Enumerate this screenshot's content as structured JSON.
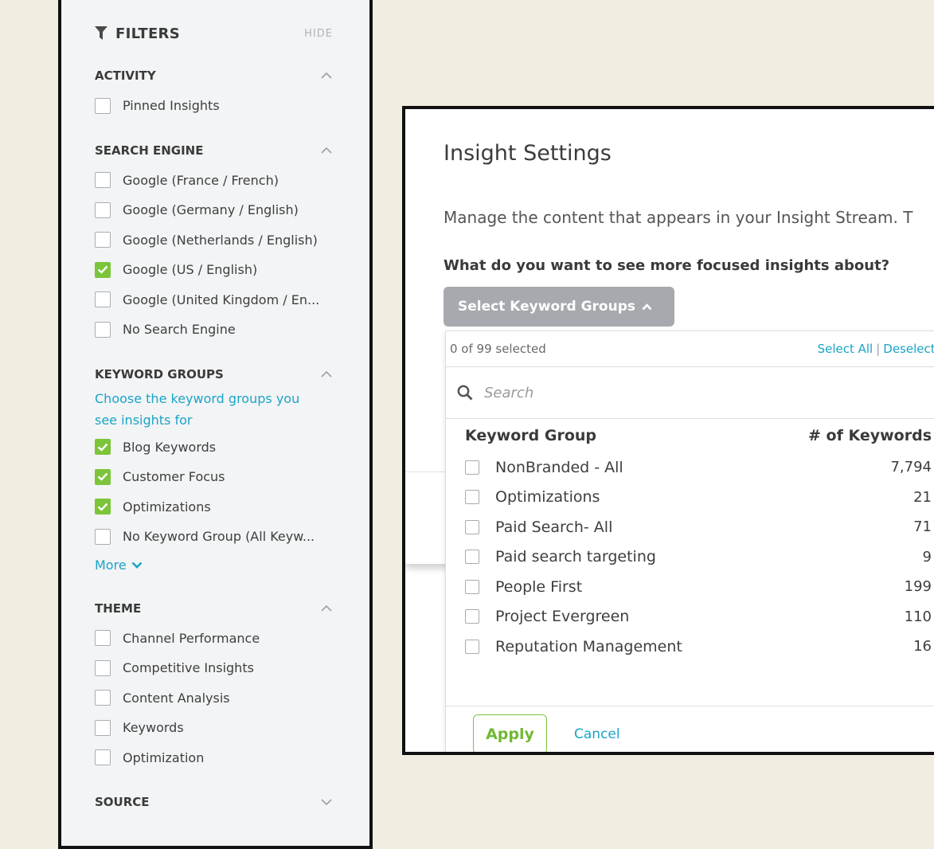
{
  "filters": {
    "title": "FILTERS",
    "hide_label": "HIDE",
    "sections": {
      "activity": {
        "title": "ACTIVITY",
        "items": [
          {
            "label": "Pinned Insights",
            "checked": false
          }
        ]
      },
      "search_engine": {
        "title": "SEARCH ENGINE",
        "items": [
          {
            "label": "Google (France / French)",
            "checked": false
          },
          {
            "label": "Google (Germany / English)",
            "checked": false
          },
          {
            "label": "Google (Netherlands / English)",
            "checked": false
          },
          {
            "label": "Google (US / English)",
            "checked": true
          },
          {
            "label": "Google (United Kingdom / En...",
            "checked": false
          },
          {
            "label": "No Search Engine",
            "checked": false
          }
        ]
      },
      "keyword_groups": {
        "title": "KEYWORD GROUPS",
        "helper": "Choose the keyword groups you see insights for",
        "items": [
          {
            "label": "Blog Keywords",
            "checked": true
          },
          {
            "label": "Customer Focus",
            "checked": true
          },
          {
            "label": "Optimizations",
            "checked": true
          },
          {
            "label": "No Keyword Group (All Keyw...",
            "checked": false
          }
        ],
        "more_label": "More"
      },
      "theme": {
        "title": "THEME",
        "items": [
          {
            "label": "Channel Performance",
            "checked": false
          },
          {
            "label": "Competitive Insights",
            "checked": false
          },
          {
            "label": "Content Analysis",
            "checked": false
          },
          {
            "label": "Keywords",
            "checked": false
          },
          {
            "label": "Optimization",
            "checked": false
          }
        ]
      },
      "source": {
        "title": "SOURCE"
      }
    }
  },
  "settings": {
    "title": "Insight Settings",
    "description": "Manage the content that appears in your Insight Stream. T",
    "question": "What do you want to see more focused insights about?",
    "keyword_button_label": "Select Keyword Groups",
    "dropdown": {
      "selected_count": "0 of 99 selected",
      "select_all": "Select All",
      "separator": "|",
      "deselect_all": "Deselect All",
      "search_placeholder": "Search",
      "col_group": "Keyword Group",
      "col_keywords": "# of Keywords",
      "rows": [
        {
          "name": "NonBranded - All",
          "count": "7,794"
        },
        {
          "name": "Optimizations",
          "count": "21"
        },
        {
          "name": "Paid Search- All",
          "count": "71"
        },
        {
          "name": "Paid search targeting",
          "count": "9"
        },
        {
          "name": "People First",
          "count": "199"
        },
        {
          "name": "Project Evergreen",
          "count": "110"
        },
        {
          "name": "Reputation Management",
          "count": "16"
        }
      ],
      "apply_label": "Apply",
      "cancel_label": "Cancel"
    }
  },
  "colors": {
    "accent_blue": "#1aa4c8",
    "check_green": "#7cc43a",
    "button_gray": "#a6a9ad"
  }
}
